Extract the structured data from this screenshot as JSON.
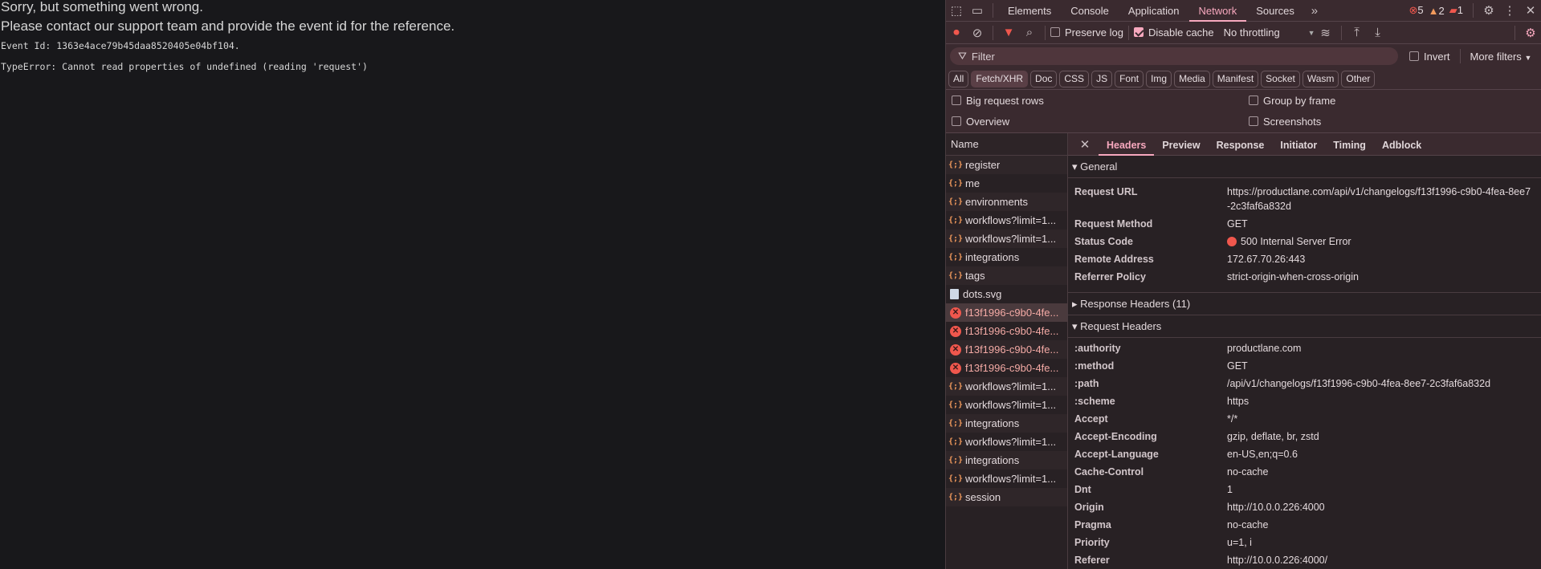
{
  "page": {
    "line1": "Sorry, but something went wrong.",
    "line2": "Please contact our support team and provide the event id for the reference.",
    "event_id": "Event Id: 1363e4ace79b45daa8520405e04bf104.",
    "error": "TypeError: Cannot read properties of undefined (reading 'request')"
  },
  "devtools": {
    "tabs": [
      "Elements",
      "Console",
      "Application",
      "Network",
      "Sources"
    ],
    "active_tab": "Network",
    "counts": {
      "errors": "5",
      "warnings": "2",
      "issues": "1"
    },
    "toolbar": {
      "preserve_log": "Preserve log",
      "disable_cache": "Disable cache",
      "throttling": "No throttling"
    },
    "filter": {
      "placeholder": "Filter",
      "invert": "Invert",
      "more_filters": "More filters"
    },
    "chips": [
      "All",
      "Fetch/XHR",
      "Doc",
      "CSS",
      "JS",
      "Font",
      "Img",
      "Media",
      "Manifest",
      "Socket",
      "Wasm",
      "Other"
    ],
    "options": {
      "big_rows": "Big request rows",
      "group_by_frame": "Group by frame",
      "overview": "Overview",
      "screenshots": "Screenshots"
    },
    "list": {
      "header": "Name",
      "rows": [
        {
          "name": "register",
          "type": "fetch"
        },
        {
          "name": "me",
          "type": "fetch"
        },
        {
          "name": "environments",
          "type": "fetch"
        },
        {
          "name": "workflows?limit=1...",
          "type": "fetch"
        },
        {
          "name": "workflows?limit=1...",
          "type": "fetch"
        },
        {
          "name": "integrations",
          "type": "fetch"
        },
        {
          "name": "tags",
          "type": "fetch"
        },
        {
          "name": "dots.svg",
          "type": "img"
        },
        {
          "name": "f13f1996-c9b0-4fe...",
          "type": "err"
        },
        {
          "name": "f13f1996-c9b0-4fe...",
          "type": "err"
        },
        {
          "name": "f13f1996-c9b0-4fe...",
          "type": "err"
        },
        {
          "name": "f13f1996-c9b0-4fe...",
          "type": "err"
        },
        {
          "name": "workflows?limit=1...",
          "type": "fetch"
        },
        {
          "name": "workflows?limit=1...",
          "type": "fetch"
        },
        {
          "name": "integrations",
          "type": "fetch"
        },
        {
          "name": "workflows?limit=1...",
          "type": "fetch"
        },
        {
          "name": "integrations",
          "type": "fetch"
        },
        {
          "name": "workflows?limit=1...",
          "type": "fetch"
        },
        {
          "name": "session",
          "type": "fetch"
        }
      ]
    },
    "detail_tabs": [
      "Headers",
      "Preview",
      "Response",
      "Initiator",
      "Timing",
      "Adblock"
    ],
    "general": {
      "title": "General",
      "rows": [
        {
          "k": "Request URL",
          "v": "https://productlane.com/api/v1/changelogs/f13f1996-c9b0-4fea-8ee7-2c3faf6a832d"
        },
        {
          "k": "Request Method",
          "v": "GET"
        },
        {
          "k": "Status Code",
          "v": "500 Internal Server Error"
        },
        {
          "k": "Remote Address",
          "v": "172.67.70.26:443"
        },
        {
          "k": "Referrer Policy",
          "v": "strict-origin-when-cross-origin"
        }
      ]
    },
    "response_headers": "Response Headers (11)",
    "request_headers": {
      "title": "Request Headers",
      "rows": [
        {
          "k": ":authority",
          "v": "productlane.com"
        },
        {
          "k": ":method",
          "v": "GET"
        },
        {
          "k": ":path",
          "v": "/api/v1/changelogs/f13f1996-c9b0-4fea-8ee7-2c3faf6a832d"
        },
        {
          "k": ":scheme",
          "v": "https"
        },
        {
          "k": "Accept",
          "v": "*/*"
        },
        {
          "k": "Accept-Encoding",
          "v": "gzip, deflate, br, zstd"
        },
        {
          "k": "Accept-Language",
          "v": "en-US,en;q=0.6"
        },
        {
          "k": "Cache-Control",
          "v": "no-cache"
        },
        {
          "k": "Dnt",
          "v": "1"
        },
        {
          "k": "Origin",
          "v": "http://10.0.0.226:4000"
        },
        {
          "k": "Pragma",
          "v": "no-cache"
        },
        {
          "k": "Priority",
          "v": "u=1, i"
        },
        {
          "k": "Referer",
          "v": "http://10.0.0.226:4000/"
        }
      ]
    }
  }
}
